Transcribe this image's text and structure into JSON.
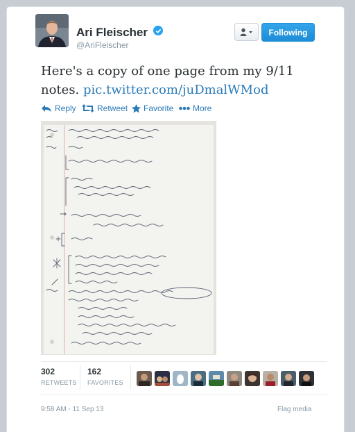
{
  "author": {
    "name": "Ari Fleischer",
    "handle": "@AriFleischer"
  },
  "buttons": {
    "follow_label": "Following"
  },
  "tweet": {
    "text": "Here's a copy of one page from my 9/11 notes.",
    "link": "pic.twitter.com/juDmalWMod"
  },
  "actions": {
    "reply": "Reply",
    "retweet": "Retweet",
    "favorite": "Favorite",
    "more": "More"
  },
  "stats": {
    "retweets_count": "302",
    "retweets_label": "RETWEETS",
    "favorites_count": "162",
    "favorites_label": "FAVORITES"
  },
  "footer": {
    "timestamp": "9:58 AM - 11 Sep 13",
    "flag_media": "Flag media"
  },
  "colors": {
    "link": "#2b7bb9",
    "follow_button": "#1e8cd6",
    "verified": "#2aa3ef",
    "muted_text": "#8899a6"
  },
  "icons": [
    "user-menu-icon",
    "verified-badge-icon",
    "reply-icon",
    "retweet-icon",
    "favorite-star-icon",
    "more-dots-icon"
  ]
}
